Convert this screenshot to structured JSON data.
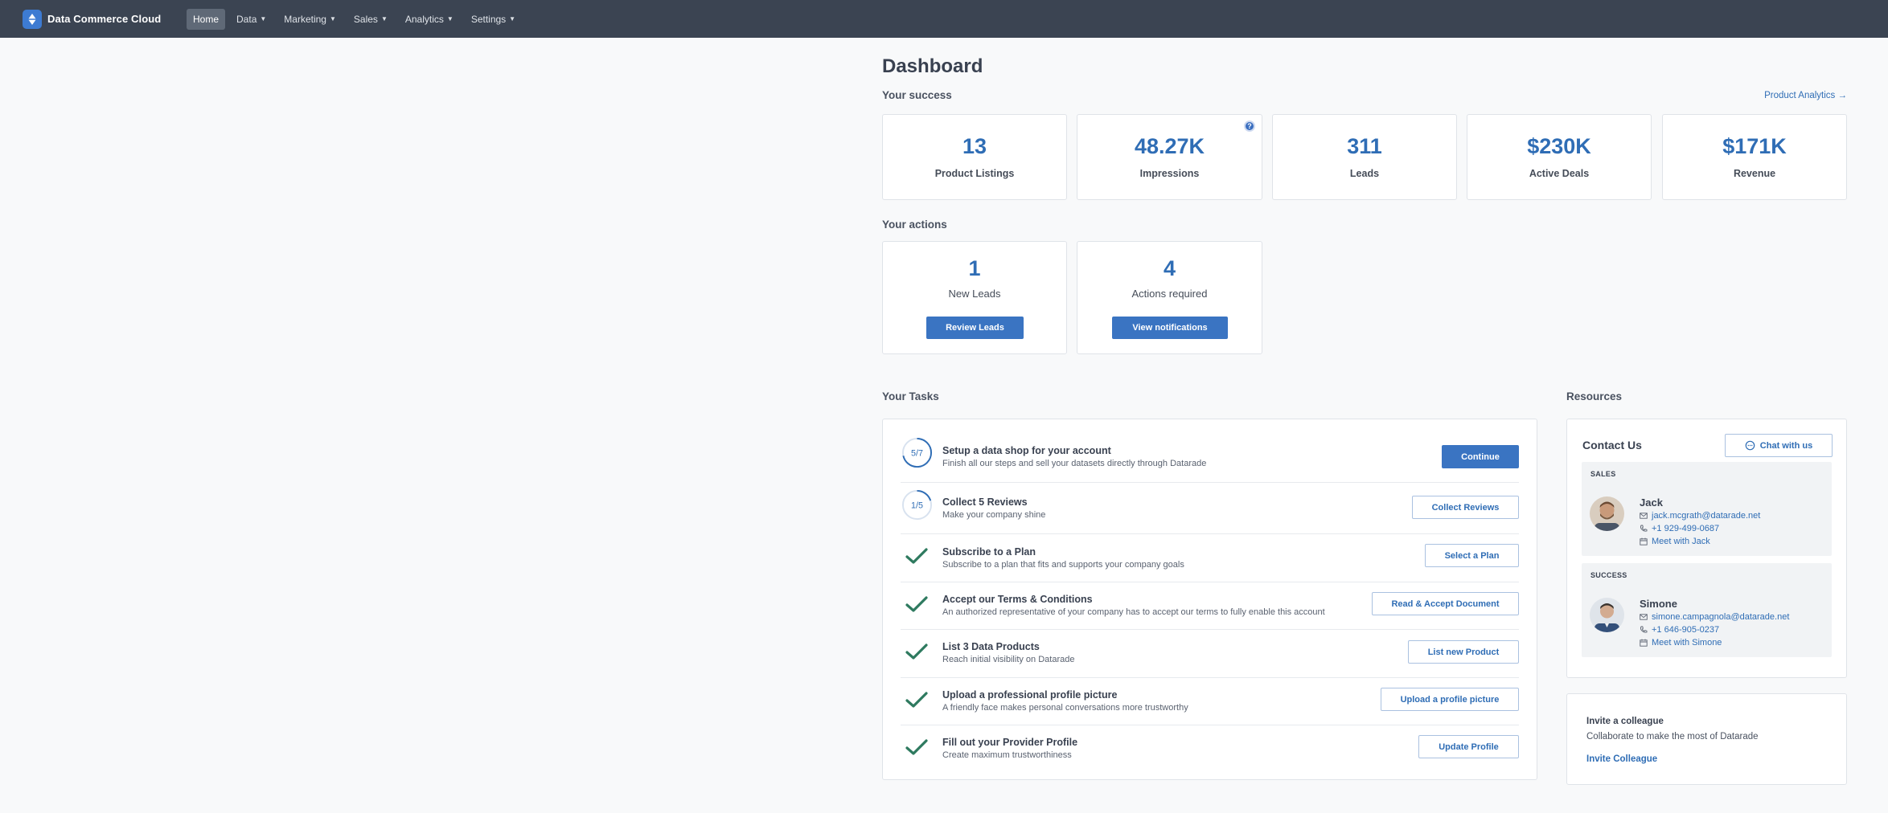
{
  "nav": {
    "brand": "Data Commerce Cloud",
    "items": [
      {
        "label": "Home",
        "active": true
      },
      {
        "label": "Data",
        "caret": true
      },
      {
        "label": "Marketing",
        "caret": true
      },
      {
        "label": "Sales",
        "caret": true
      },
      {
        "label": "Analytics",
        "caret": true
      },
      {
        "label": "Settings",
        "caret": true
      }
    ]
  },
  "page": {
    "title": "Dashboard",
    "success_label": "Your success",
    "product_analytics": "Product Analytics →",
    "actions_label": "Your actions",
    "tasks_label": "Your Tasks",
    "resources_label": "Resources"
  },
  "stats": [
    {
      "value": "13",
      "label": "Product Listings"
    },
    {
      "value": "48.27K",
      "label": "Impressions",
      "help": "?"
    },
    {
      "value": "311",
      "label": "Leads"
    },
    {
      "value": "$230K",
      "label": "Active Deals"
    },
    {
      "value": "$171K",
      "label": "Revenue"
    }
  ],
  "actions": [
    {
      "value": "1",
      "label": "New Leads",
      "button": "Review Leads"
    },
    {
      "value": "4",
      "label": "Actions required",
      "button": "View notifications"
    }
  ],
  "tasks": [
    {
      "progress": "5/7",
      "progress_fraction": 0.714,
      "title": "Setup a data shop for your account",
      "desc": "Finish all our steps and sell your datasets directly through Datarade",
      "button": "Continue",
      "primary": true
    },
    {
      "progress": "1/5",
      "progress_fraction": 0.2,
      "title": "Collect 5 Reviews",
      "desc": "Make your company shine",
      "button": "Collect Reviews"
    },
    {
      "done": true,
      "title": "Subscribe to a Plan",
      "desc": "Subscribe to a plan that fits and supports your company goals",
      "button": "Select a Plan"
    },
    {
      "done": true,
      "title": "Accept our Terms & Conditions",
      "desc": "An authorized representative of your company has to accept our terms to fully enable this account",
      "button": "Read & Accept Document"
    },
    {
      "done": true,
      "title": "List 3 Data Products",
      "desc": "Reach initial visibility on Datarade",
      "button": "List new Product"
    },
    {
      "done": true,
      "title": "Upload a professional profile picture",
      "desc": "A friendly face makes personal conversations more trustworthy",
      "button": "Upload a profile picture"
    },
    {
      "done": true,
      "title": "Fill out your Provider Profile",
      "desc": "Create maximum trustworthiness",
      "button": "Update Profile"
    }
  ],
  "contact": {
    "title": "Contact Us",
    "chat_button": "Chat with us",
    "people": [
      {
        "role": "SALES",
        "name": "Jack",
        "email": "jack.mcgrath@datarade.net",
        "phone": "+1 929-499-0687",
        "meet": "Meet with Jack"
      },
      {
        "role": "SUCCESS",
        "name": "Simone",
        "email": "simone.campagnola@datarade.net",
        "phone": "+1 646-905-0237",
        "meet": "Meet with Simone"
      }
    ]
  },
  "invite": {
    "title": "Invite a colleague",
    "desc": "Collaborate to make the most of Datarade",
    "link": "Invite Colleague"
  },
  "colors": {
    "nav_bg": "#3b4452",
    "accent": "#2f6db5",
    "primary_button": "#3a74c2",
    "check_green": "#2e7a5f"
  }
}
